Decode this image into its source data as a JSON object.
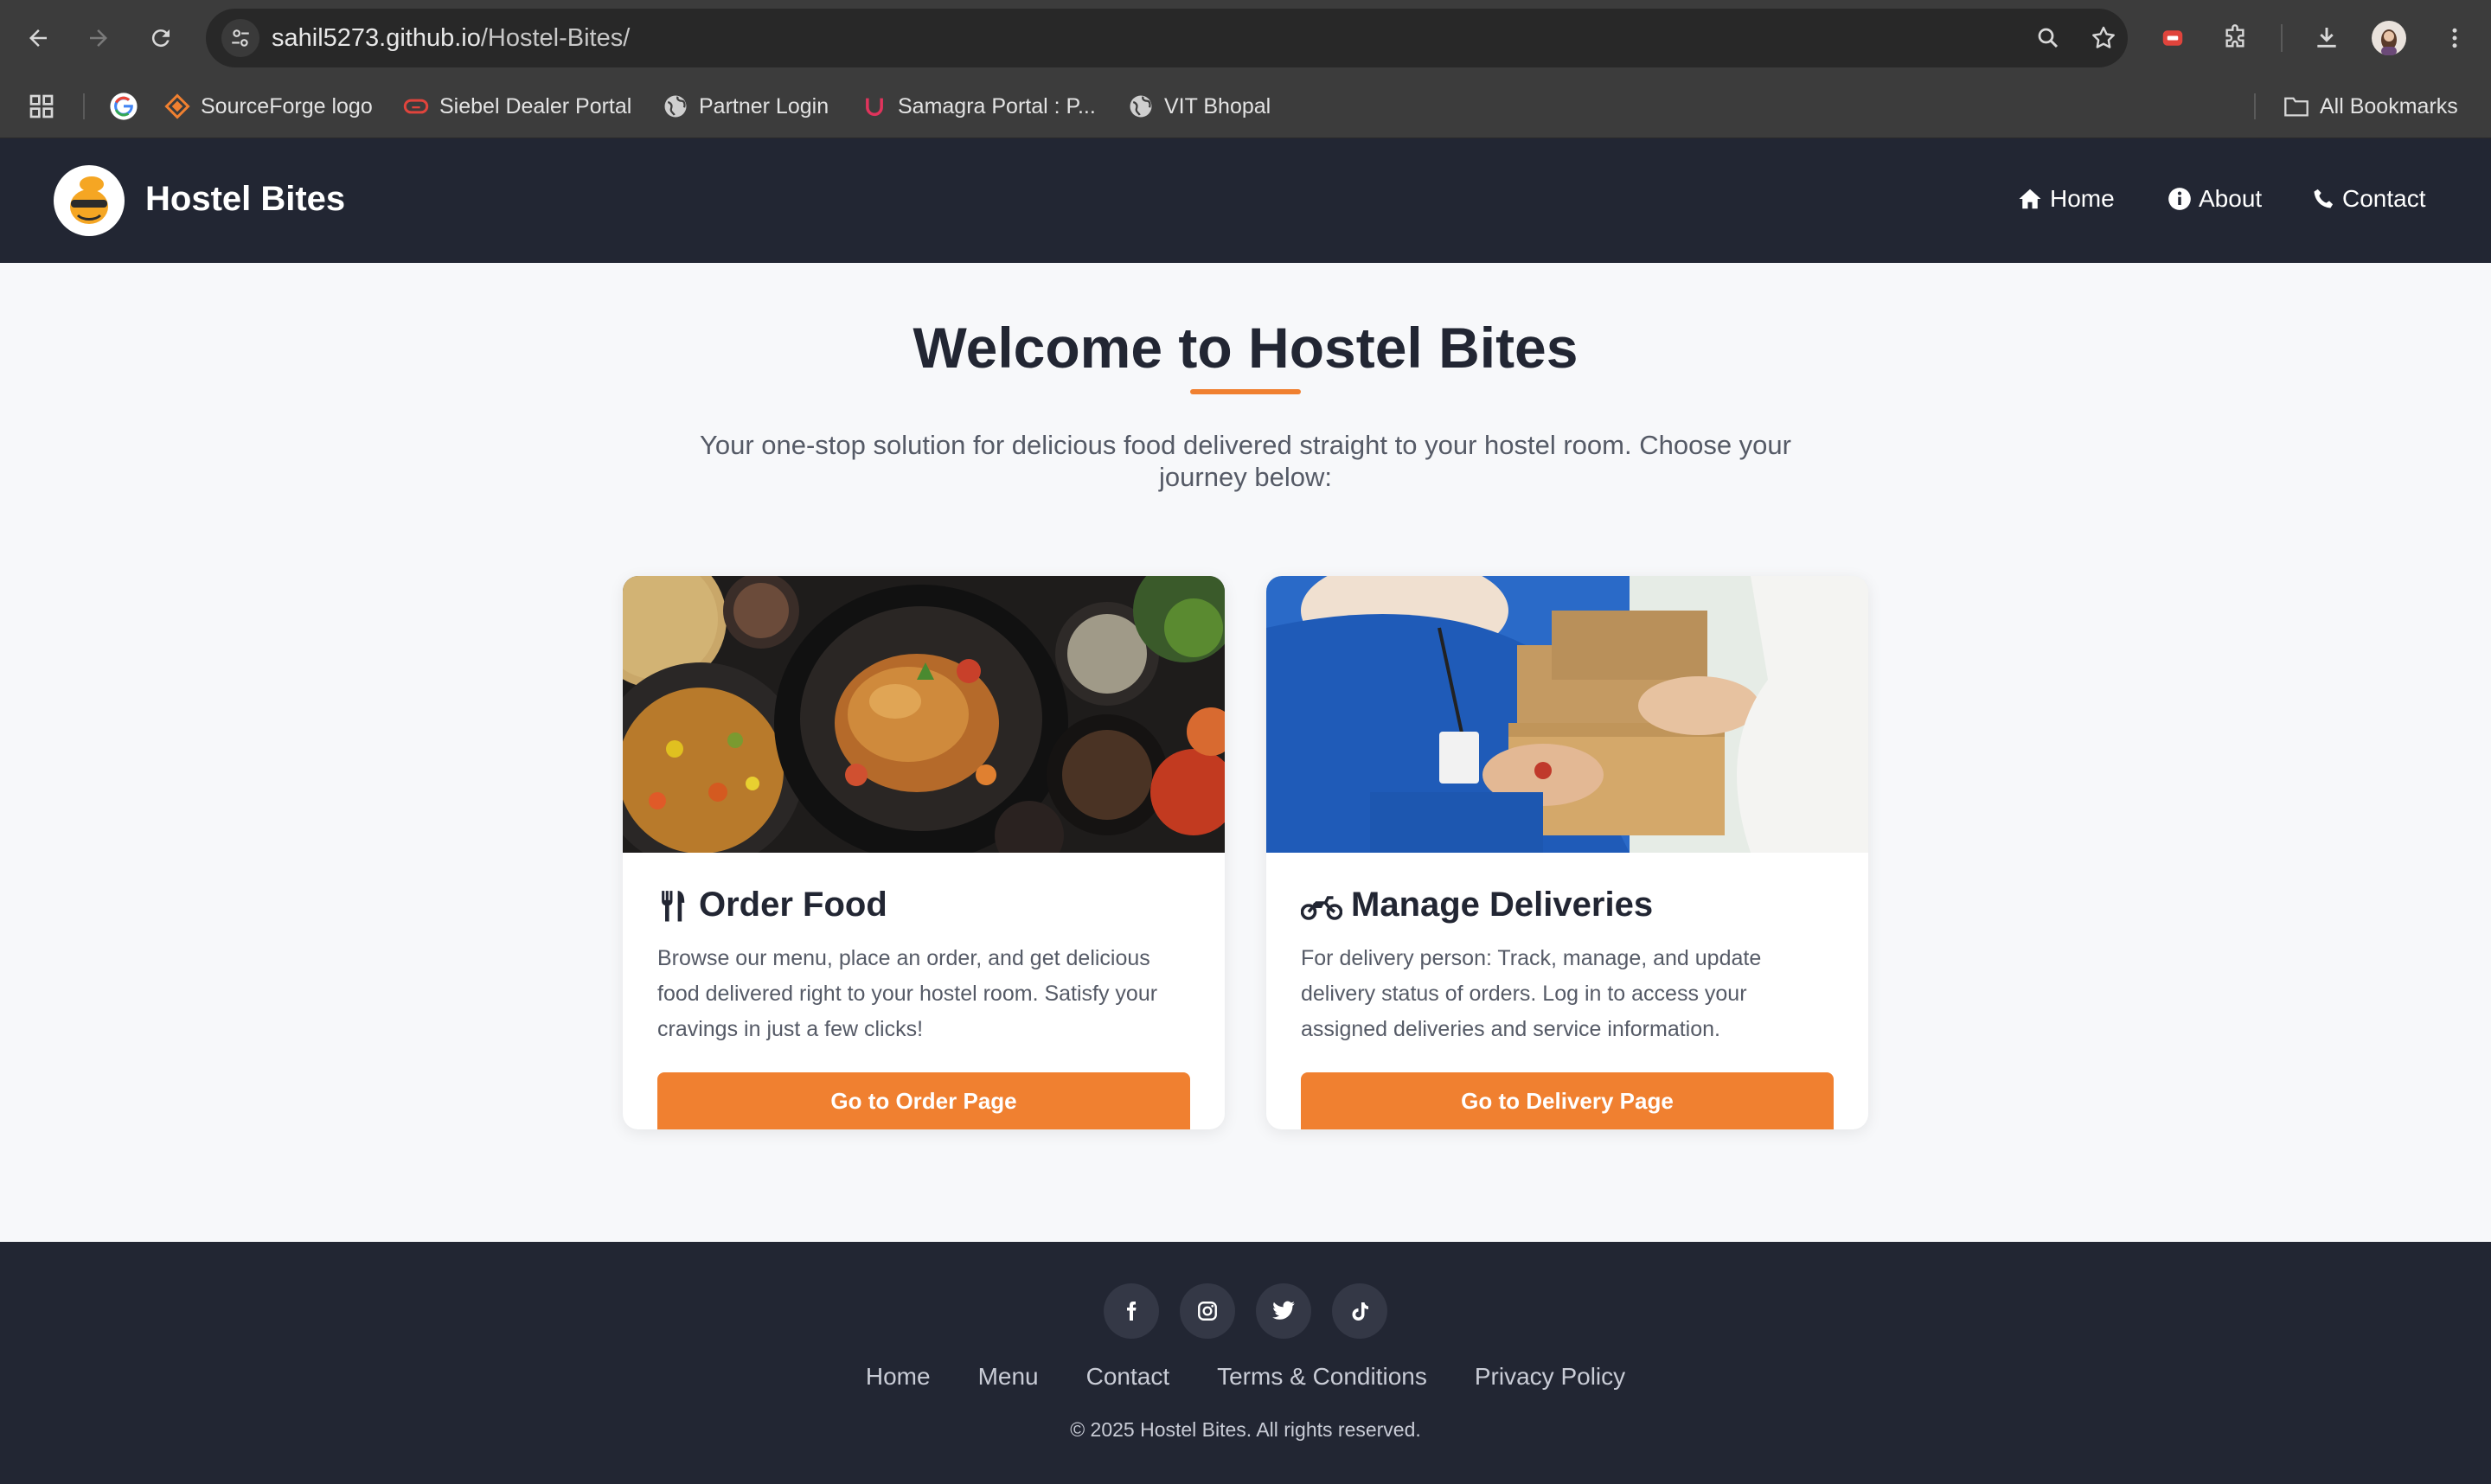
{
  "browser": {
    "url_host": "sahil5273.github.io",
    "url_path": "/Hostel-Bites/",
    "bookmarks": [
      {
        "label": "SourceForge logo",
        "icon": "sourceforge-icon"
      },
      {
        "label": "Siebel Dealer Portal",
        "icon": "siebel-icon"
      },
      {
        "label": "Partner Login",
        "icon": "globe-icon"
      },
      {
        "label": "Samagra Portal : P...",
        "icon": "samagra-icon"
      },
      {
        "label": "VIT Bhopal",
        "icon": "globe-icon"
      }
    ],
    "all_bookmarks": "All Bookmarks"
  },
  "header": {
    "brand": "Hostel Bites",
    "nav": [
      {
        "label": "Home",
        "icon": "home-icon"
      },
      {
        "label": "About",
        "icon": "info-icon"
      },
      {
        "label": "Contact",
        "icon": "phone-icon"
      }
    ]
  },
  "hero": {
    "title": "Welcome to Hostel Bites",
    "subtitle": "Your one-stop solution for delicious food delivered straight to your hostel room. Choose your journey below:"
  },
  "cards": [
    {
      "title": "Order Food",
      "icon": "utensils-icon",
      "description": "Browse our menu, place an order, and get delicious food delivered right to your hostel room. Satisfy your cravings in just a few clicks!",
      "button": "Go to Order Page"
    },
    {
      "title": "Manage Deliveries",
      "icon": "motorcycle-icon",
      "description": "For delivery person: Track, manage, and update delivery status of orders. Log in to access your assigned deliveries and service information.",
      "button": "Go to Delivery Page"
    }
  ],
  "footer": {
    "social": [
      "facebook-icon",
      "instagram-icon",
      "twitter-icon",
      "tiktok-icon"
    ],
    "links": [
      "Home",
      "Menu",
      "Contact",
      "Terms & Conditions",
      "Privacy Policy"
    ],
    "copyright": "© 2025 Hostel Bites. All rights reserved."
  },
  "colors": {
    "accent": "#f08030",
    "header_bg": "#222633",
    "page_bg": "#f7f8fa"
  }
}
